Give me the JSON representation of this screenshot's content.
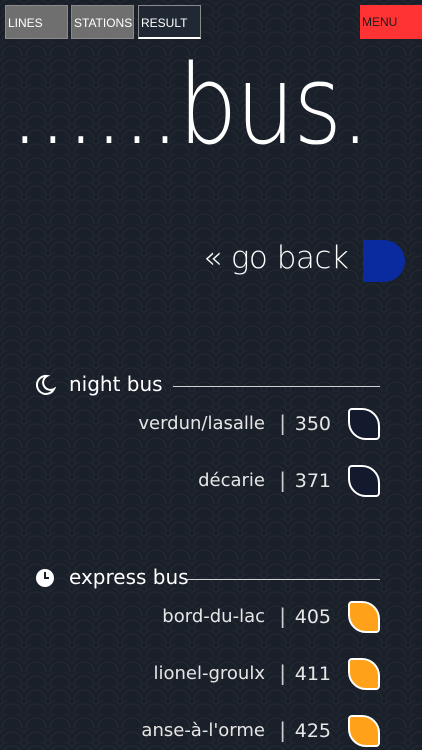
{
  "tabs": [
    {
      "label": "LINES"
    },
    {
      "label": "STATIONS"
    },
    {
      "label": "RESULT"
    }
  ],
  "menu_label": "MENU",
  "hero_text": "......bus.",
  "go_back": "« go back",
  "sections": {
    "night": {
      "title": "night bus",
      "icon": "moon-icon",
      "rows": [
        {
          "name": "verdun/lasalle",
          "sep": "|",
          "number": "350"
        },
        {
          "name": "décarie",
          "sep": "|",
          "number": "371"
        }
      ]
    },
    "express": {
      "title": "express bus",
      "icon": "clock-icon",
      "rows": [
        {
          "name": "bord-du-lac",
          "sep": "|",
          "number": "405"
        },
        {
          "name": "lionel-groulx",
          "sep": "|",
          "number": "411"
        },
        {
          "name": "anse-à-l'orme",
          "sep": "|",
          "number": "425"
        }
      ]
    }
  },
  "colors": {
    "background": "#1a2029",
    "menu": "#ff3333",
    "tab": "#6f6f6f",
    "accent_blue": "#0a2a9f",
    "night_badge": "#141a2e",
    "express_badge": "#ffa21a"
  }
}
